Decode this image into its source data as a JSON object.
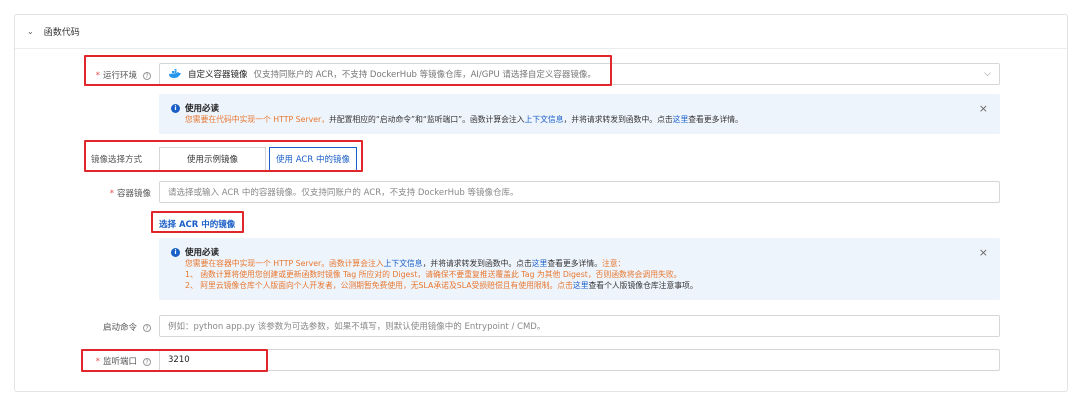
{
  "section": {
    "chevron": "chevron-down",
    "title": "函数代码"
  },
  "runtime": {
    "label": "运行环境",
    "required_mark": "*",
    "help_glyph": "?",
    "icon": "docker-whale-icon",
    "selected": "自定义容器镜像",
    "description": "仅支持同账户的 ACR，不支持 DockerHub 等镜像仓库，AI/GPU 请选择自定义容器镜像。",
    "caret": "⌵"
  },
  "alert1": {
    "info_glyph": "i",
    "title": "使用必读",
    "line_pre": "您需要在代码中实现一个 HTTP Server，",
    "line_dark": "并配置相应的“启动命令”和“监听端口”。函数计算会注入",
    "line_link1": "上下文信息",
    "line_dark2": "，并将请求转发到函数中。点击",
    "line_link2": "这里",
    "line_dark3": "查看更多详情。",
    "close": "×"
  },
  "image_mode": {
    "label": "镜像选择方式",
    "options": [
      "使用示例镜像",
      "使用 ACR 中的镜像"
    ],
    "active_index": 1
  },
  "container_image": {
    "label": "容器镜像",
    "required_mark": "*",
    "placeholder": "请选择或输入 ACR 中的容器镜像。仅支持同账户的 ACR，不支持 DockerHub 等镜像仓库。",
    "select_link": "选择 ACR 中的镜像"
  },
  "alert2": {
    "info_glyph": "i",
    "title": "使用必读",
    "l1_pre": "您需要在容器中实现一个 HTTP Server。函数计算会注入",
    "l1_link1": "上下文信息",
    "l1_mid": "，并将请求转发到函数中。点击",
    "l1_link2": "这里",
    "l1_mid2": "查看更多详情。",
    "l1_note": "注意：",
    "l2": "1、 函数计算将使用您创建或更新函数时镜像 Tag 所应对的 Digest，请确保不要重复推送覆盖此 Tag 为其他 Digest，否则函数将会调用失败。",
    "l3_pre": "2、 阿里云镜像仓库个人版面向个人开发者，公测期暂免费使用，无SLA承诺及SLA受损赔偿且有使用限制。点击",
    "l3_link": "这里",
    "l3_post": "查看个人版镜像仓库注意事项。",
    "close": "×"
  },
  "startup": {
    "label": "启动命令",
    "help_glyph": "?",
    "placeholder": "例如：python app.py 该参数为可选参数，如果不填写，则默认使用镜像中的 Entrypoint / CMD。"
  },
  "port": {
    "label": "监听端口",
    "required_mark": "*",
    "help_glyph": "?",
    "value": "3210"
  }
}
